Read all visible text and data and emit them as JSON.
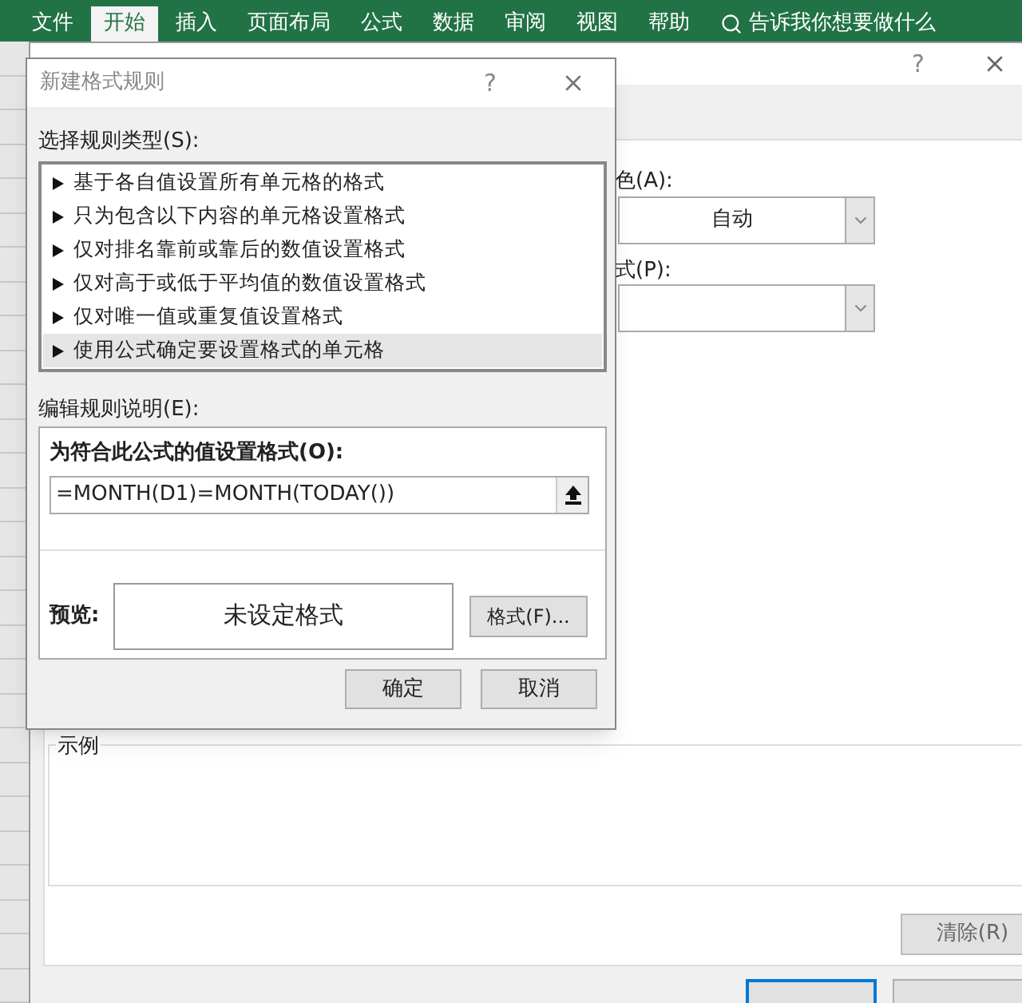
{
  "ribbon": {
    "tabs": [
      {
        "label": "文件",
        "selected": false
      },
      {
        "label": "开始",
        "selected": true
      },
      {
        "label": "插入",
        "selected": false
      },
      {
        "label": "页面布局",
        "selected": false
      },
      {
        "label": "公式",
        "selected": false
      },
      {
        "label": "数据",
        "selected": false
      },
      {
        "label": "审阅",
        "selected": false
      },
      {
        "label": "视图",
        "selected": false
      },
      {
        "label": "帮助",
        "selected": false
      }
    ],
    "search": "告诉我你想要做什么"
  },
  "back_dialog": {
    "help": "?",
    "color_label": "色(A):",
    "color_value": "自动",
    "style_label": "式(P):",
    "sample_label": "示例",
    "clear_button": "清除(R)"
  },
  "dialog": {
    "title": "新建格式规则",
    "help": "?",
    "rule_type_label": "选择规则类型(S):",
    "rule_types": [
      {
        "label": "基于各自值设置所有单元格的格式",
        "selected": false
      },
      {
        "label": "只为包含以下内容的单元格设置格式",
        "selected": false
      },
      {
        "label": "仅对排名靠前或靠后的数值设置格式",
        "selected": false
      },
      {
        "label": "仅对高于或低于平均值的数值设置格式",
        "selected": false
      },
      {
        "label": "仅对唯一值或重复值设置格式",
        "selected": false
      },
      {
        "label": "使用公式确定要设置格式的单元格",
        "selected": true
      }
    ],
    "edit_label": "编辑规则说明(E):",
    "formula_label": "为符合此公式的值设置格式(O):",
    "formula": "=MONTH(D1)=MONTH(TODAY())",
    "preview_label": "预览:",
    "preview_text": "未设定格式",
    "format_button": "格式(F)...",
    "buttons": [
      "确定",
      "取消"
    ]
  }
}
